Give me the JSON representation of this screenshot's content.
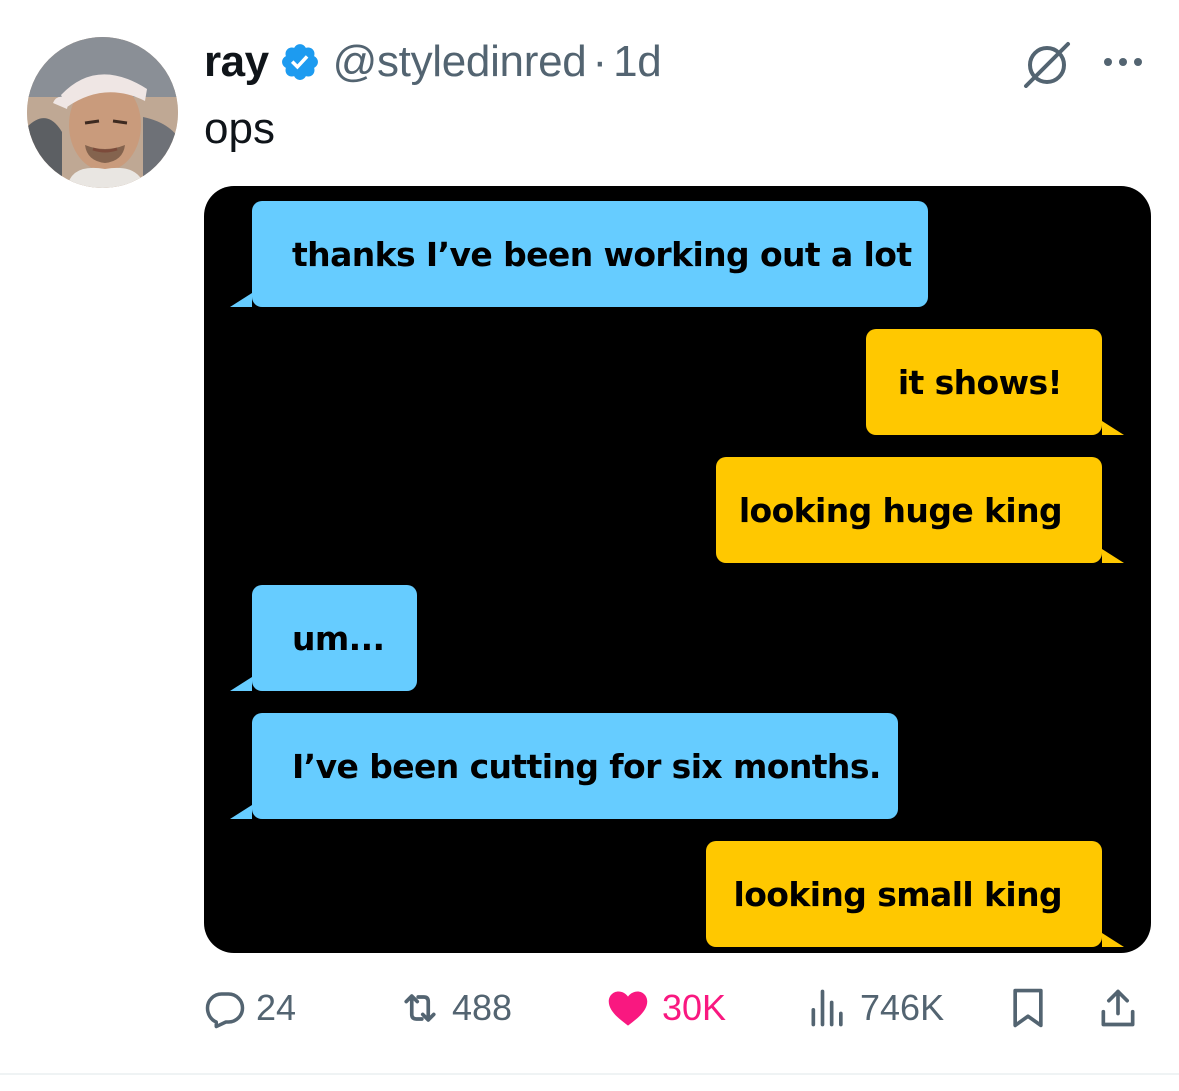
{
  "author": {
    "display_name": "ray",
    "handle": "@styledinred",
    "separator": "·",
    "time": "1d",
    "verified": true,
    "avatar_icon": "user-avatar-photo"
  },
  "tweet": {
    "text": "ops"
  },
  "media": {
    "background": "#000000",
    "bubble_colors": {
      "received": "#66ccff",
      "sent": "#ffc800"
    },
    "messages": [
      {
        "side": "left",
        "text": "thanks I’ve been working out a lot"
      },
      {
        "side": "right",
        "text": "it shows!"
      },
      {
        "side": "right",
        "text": "looking huge king"
      },
      {
        "side": "left",
        "text": "um..."
      },
      {
        "side": "left",
        "text": "I’ve been cutting for six months."
      },
      {
        "side": "right",
        "text": "looking small king"
      }
    ]
  },
  "header_icons": {
    "grok": "grok-icon",
    "more": "more-horizontal-icon"
  },
  "actions": {
    "replies": {
      "icon": "reply-icon",
      "count": "24"
    },
    "reposts": {
      "icon": "repost-icon",
      "count": "488"
    },
    "likes": {
      "icon": "heart-icon",
      "count": "30K",
      "active": true,
      "color": "#f91880"
    },
    "views": {
      "icon": "views-icon",
      "count": "746K"
    },
    "bookmark": {
      "icon": "bookmark-icon"
    },
    "share": {
      "icon": "share-icon"
    }
  },
  "colors": {
    "text_primary": "#0f1419",
    "text_secondary": "#536471",
    "verified_blue": "#1d9bf0"
  }
}
